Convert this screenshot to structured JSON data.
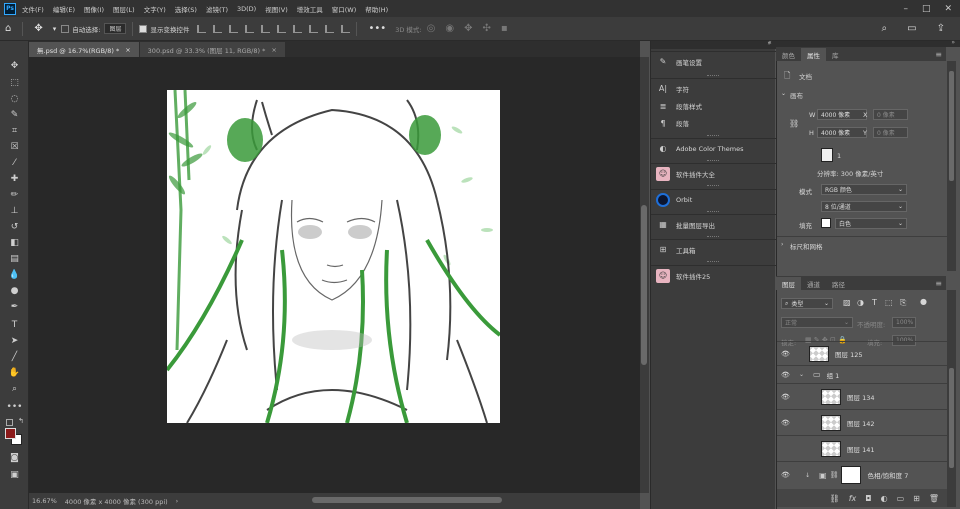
{
  "menu": [
    "文件(F)",
    "编辑(E)",
    "图像(I)",
    "图层(L)",
    "文字(Y)",
    "选择(S)",
    "滤镜(T)",
    "3D(D)",
    "视图(V)",
    "增效工具",
    "窗口(W)",
    "帮助(H)"
  ],
  "options": {
    "auto_select_label": "自动选择:",
    "auto_select_value": "图层",
    "show_transform_label": "显示变换控件",
    "mode_3d": "3D 模式:"
  },
  "tabs": [
    {
      "label": "無.psd @ 16.7%(RGB/8) *",
      "active": true
    },
    {
      "label": "300.psd @ 33.3% (图层 11, RGB/8) *",
      "active": false
    }
  ],
  "status": {
    "zoom": "16.67%",
    "doc": "4000 像素 x 4000 像素 (300 ppi)"
  },
  "dock": [
    {
      "icon": "brush-settings-icon",
      "label": "画笔设置"
    },
    {
      "icon": "char-icon",
      "label": "字符"
    },
    {
      "icon": "para-icon",
      "label": "段落样式"
    },
    {
      "icon": "pilcrow-icon",
      "label": "段落"
    },
    {
      "icon": "cc-icon",
      "label": "Adobe Color Themes"
    },
    {
      "icon": "plugin-avatar-icon",
      "label": "软件插件大全"
    },
    {
      "icon": "orbit-icon",
      "label": "Orbit"
    },
    {
      "icon": "batch-icon",
      "label": "批量图层导出"
    },
    {
      "icon": "plugin-icon",
      "label": "工具箱"
    },
    {
      "icon": "plugin-avatar2-icon",
      "label": "软件插件25"
    }
  ],
  "properties": {
    "tabs": [
      "颜色",
      "属性",
      "库"
    ],
    "doc_label": "文档",
    "canvas_section": "画布",
    "w_label": "W",
    "w_value": "4000 像素",
    "h_label": "H",
    "h_value": "4000 像素",
    "x_label": "X",
    "x_value": "0 像素",
    "y_label": "Y",
    "y_value": "0 像素",
    "orient": "1",
    "resolution": "分辨率: 300 像素/英寸",
    "mode_label": "模式",
    "mode_value": "RGB 颜色",
    "bits_value": "8 位/通道",
    "fill_label": "填充",
    "fill_value": "白色",
    "ruler_section": "标尺和网格"
  },
  "layers": {
    "tabs": [
      "图层",
      "通道",
      "路径"
    ],
    "kind_label": "类型",
    "blend": "正常",
    "opacity_label": "不透明度:",
    "opacity": "100%",
    "lock_label": "锁定:",
    "fill_label": "填充:",
    "fill": "100%",
    "rows": [
      {
        "name": "图层 125",
        "indent": 0,
        "eye": true,
        "type": "layer"
      },
      {
        "name": "组 1",
        "indent": 0,
        "eye": true,
        "type": "group"
      },
      {
        "name": "图层 134",
        "indent": 1,
        "eye": true,
        "type": "layer"
      },
      {
        "name": "图层 142",
        "indent": 1,
        "eye": true,
        "type": "layer"
      },
      {
        "name": "图层 141",
        "indent": 1,
        "eye": false,
        "type": "layer"
      },
      {
        "name": "色相/饱和度 7",
        "indent": 1,
        "eye": true,
        "type": "adjust"
      }
    ]
  },
  "colors": {
    "accent": "#31a8ff",
    "foreground": "#8b1a1a",
    "background": "#ffffff",
    "green": "#3a9a3a"
  }
}
